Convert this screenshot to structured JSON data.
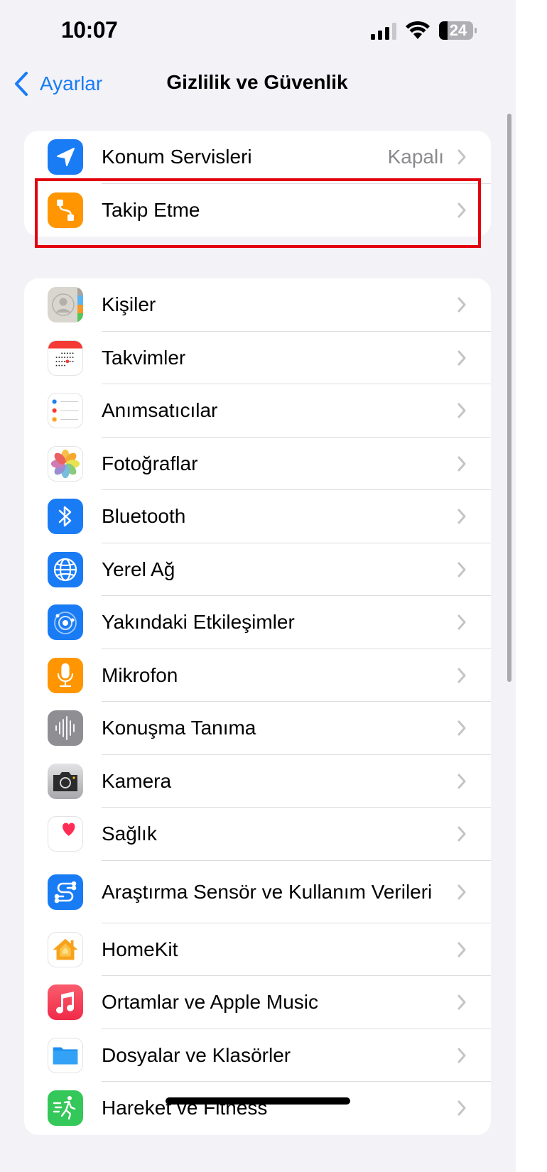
{
  "status_bar": {
    "time": "10:07",
    "battery_level": "24",
    "signal_bars_active": 3,
    "signal_bars_total": 4
  },
  "nav": {
    "back_label": "Ayarlar",
    "title": "Gizlilik ve Güvenlik"
  },
  "group1": {
    "items": [
      {
        "label": "Konum Servisleri",
        "value": "Kapalı",
        "icon": "location-arrow-icon",
        "color": "#1a7cf5"
      },
      {
        "label": "Takip Etme",
        "value": "",
        "icon": "tracking-icon",
        "color": "#ff9500"
      }
    ]
  },
  "group2": {
    "items": [
      {
        "label": "Kişiler",
        "icon": "contacts-icon"
      },
      {
        "label": "Takvimler",
        "icon": "calendar-icon"
      },
      {
        "label": "Anımsatıcılar",
        "icon": "reminders-icon"
      },
      {
        "label": "Fotoğraflar",
        "icon": "photos-icon"
      },
      {
        "label": "Bluetooth",
        "icon": "bluetooth-icon"
      },
      {
        "label": "Yerel Ağ",
        "icon": "globe-icon"
      },
      {
        "label": "Yakındaki Etkileşimler",
        "icon": "nearby-interactions-icon"
      },
      {
        "label": "Mikrofon",
        "icon": "microphone-icon"
      },
      {
        "label": "Konuşma Tanıma",
        "icon": "waveform-icon"
      },
      {
        "label": "Kamera",
        "icon": "camera-icon"
      },
      {
        "label": "Sağlık",
        "icon": "heart-icon"
      },
      {
        "label": "Araştırma Sensör ve Kullanım Verileri",
        "icon": "research-icon"
      },
      {
        "label": "HomeKit",
        "icon": "home-icon"
      },
      {
        "label": "Ortamlar ve Apple Music",
        "icon": "music-icon"
      },
      {
        "label": "Dosyalar ve Klasörler",
        "icon": "folder-icon"
      },
      {
        "label": "Hareket ve Fitness",
        "icon": "fitness-icon"
      }
    ]
  },
  "colors": {
    "accent": "#1a7cf5",
    "background": "#f2f2f7",
    "highlight": "#e3000f"
  }
}
